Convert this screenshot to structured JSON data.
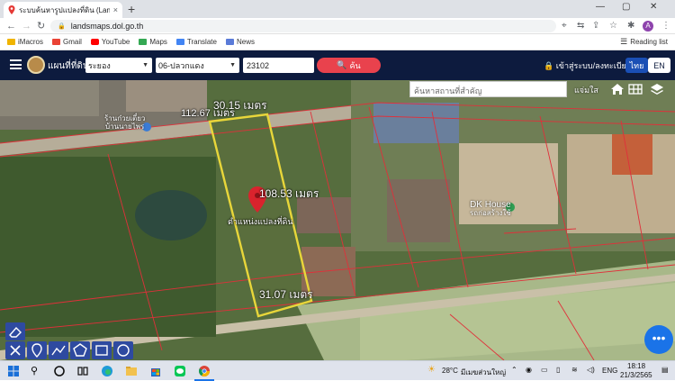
{
  "browser": {
    "tab_title": "ระบบค้นหารูปแปลงที่ดิน (LandsMaps)",
    "tab_close": "×",
    "new_tab": "+",
    "url": "landsmaps.dol.go.th",
    "bookmarks": [
      {
        "label": "iMacros",
        "color": "#f0b400"
      },
      {
        "label": "Gmail",
        "color": "#ea4335"
      },
      {
        "label": "YouTube",
        "color": "#ff0000"
      },
      {
        "label": "Maps",
        "color": "#34a853"
      },
      {
        "label": "Translate",
        "color": "#4285f4"
      },
      {
        "label": "News",
        "color": "#5a7bd8"
      }
    ],
    "reading_list": "Reading list",
    "profile_initial": "A"
  },
  "app": {
    "title": "แผนที่ที่ดิน",
    "province": "ระยอง",
    "district": "06-ปลวกแดง",
    "parcel_no": "23102",
    "search_label": "ค้น",
    "login_label": "เข้าสู่ระบบ/ลงทะเบียน",
    "lang_th": "ไทย",
    "lang_en": "EN"
  },
  "map": {
    "search_placeholder": "ค้นหาสถานที่สำคัญ",
    "weather_label": "แจ่มใส",
    "measure_top_a": "112.67 เมตร",
    "measure_top_b": "30.15 เมตร",
    "measure_right": "108.53 เมตร",
    "measure_bottom": "31.07 เมตร",
    "parcel_label": "ตำแหน่งแปลงที่ดิน",
    "poi_left": "ร้านก๋วยเตี๋ยว\nบ้านนายไพร",
    "poi_right_name": "DK House",
    "poi_right_sub": "รถก่อสร้างใช้",
    "fab_label": "•••"
  },
  "taskbar": {
    "temp": "28°C",
    "weather": "มีเมฆส่วนใหญ่",
    "lang": "ENG",
    "time": "18:18",
    "date": "21/3/2565"
  },
  "colors": {
    "header_bg": "#0d1b3e",
    "search_red": "#e9424d",
    "parcel_outline": "#e8d63a",
    "boundary_red": "#e0303a",
    "fab_blue": "#1a73e8"
  }
}
